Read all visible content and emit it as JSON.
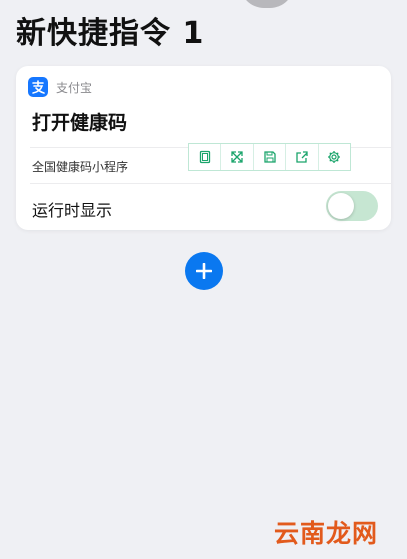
{
  "page": {
    "title": "新快捷指令 1"
  },
  "card": {
    "app_name": "支付宝",
    "action_title": "打开健康码",
    "param_label": "全国健康码小程序",
    "toggle_label": "运行时显示",
    "toggle_on": false
  },
  "toolbar": {
    "icons": [
      "copy-icon",
      "shuffle-icon",
      "save-icon",
      "share-icon",
      "settings-icon"
    ]
  },
  "colors": {
    "accent": "#0a78f0",
    "alipay": "#1677ff",
    "toolbar_icon": "#1aa46b",
    "watermark": "#e25a1c"
  },
  "watermark": "云南龙网"
}
